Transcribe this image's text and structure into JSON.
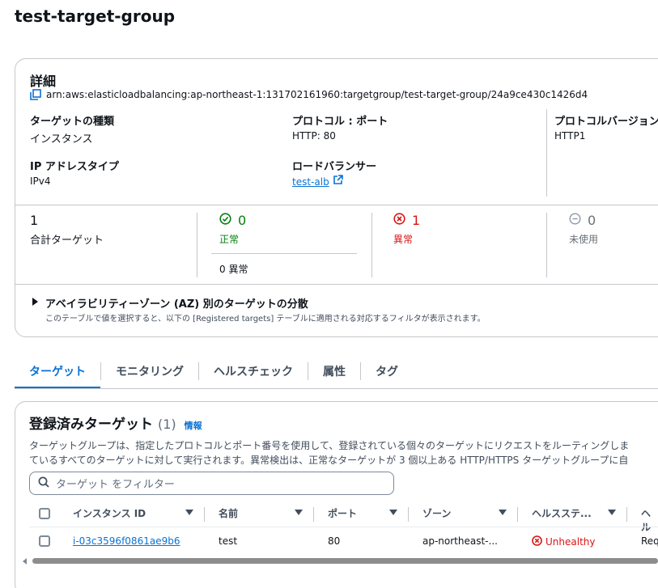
{
  "page_title": "test-target-group",
  "details": {
    "heading": "詳細",
    "arn": "arn:aws:elasticloadbalancing:ap-northeast-1:131702161960:targetgroup/test-target-group/24a9ce430c1426d4",
    "target_type_label": "ターゲットの種類",
    "target_type_value": "インスタンス",
    "protocol_port_label": "プロトコル : ポート",
    "protocol_port_value": "HTTP: 80",
    "protocol_version_label": "プロトコルバージョン",
    "protocol_version_value": "HTTP1",
    "ip_type_label": "IP アドレスタイプ",
    "ip_type_value": "IPv4",
    "lb_label": "ロードバランサー",
    "lb_value": "test-alb"
  },
  "summary": {
    "total_count": "1",
    "total_label": "合計ターゲット",
    "healthy_count": "0",
    "healthy_label": "正常",
    "healthy_anomaly": "0 異常",
    "unhealthy_count": "1",
    "unhealthy_label": "異常",
    "unused_count": "0",
    "unused_label": "未使用"
  },
  "az": {
    "title": "アベイラビリティーゾーン (AZ) 別のターゲットの分散",
    "description": "このテーブルで値を選択すると、以下の [Registered targets] テーブルに適用される対応するフィルタが表示されます。"
  },
  "tabs": [
    {
      "label": "ターゲット",
      "active": true
    },
    {
      "label": "モニタリング",
      "active": false
    },
    {
      "label": "ヘルスチェック",
      "active": false
    },
    {
      "label": "属性",
      "active": false
    },
    {
      "label": "タグ",
      "active": false
    }
  ],
  "registered": {
    "heading": "登録済みターゲット",
    "count": "(1)",
    "info": "情報",
    "description_line1": "ターゲットグループは、指定したプロトコルとポート番号を使用して、登録されている個々のターゲットにリクエストをルーティングしま",
    "description_line2": "ているすべてのターゲットに対して実行されます。異常検出は、正常なターゲットが 3 個以上ある HTTP/HTTPS ターゲットグループに自",
    "search_placeholder": "ターゲット をフィルター",
    "columns": [
      "インスタンス ID",
      "名前",
      "ポート",
      "ゾーン",
      "ヘルスステ...",
      "ヘル"
    ],
    "rows": [
      {
        "instance_id": "i-03c3596f0861ae9b6",
        "name": "test",
        "port": "80",
        "zone": "ap-northeast-...",
        "health": "Unhealthy",
        "health_detail": "Req"
      }
    ]
  },
  "colors": {
    "accent": "#0972d3",
    "healthy": "#037f0c",
    "unhealthy": "#d91515",
    "muted": "#687078"
  }
}
